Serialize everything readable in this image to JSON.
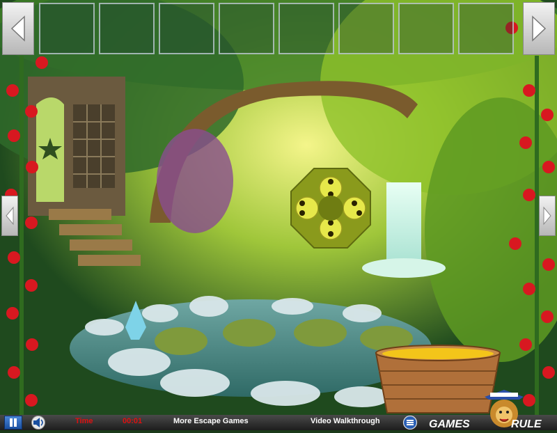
{
  "bottom_bar": {
    "time_label": "Time",
    "time_value": "00:01",
    "more_games": "More Escape Games",
    "walkthrough": "Video Walkthrough",
    "logo_left": "GAMES",
    "logo_right": "RULE"
  },
  "colors": {
    "time_red": "#e01010",
    "puzzle_green": "#8a9a1c",
    "bowl_liquid": "#f3c51a",
    "bowl_wood": "#b0703a"
  },
  "inventory": {
    "slot_count": 8
  },
  "icons": [
    "pause-icon",
    "sound-icon",
    "menu-icon",
    "arrow-left-icon",
    "arrow-right-icon",
    "spade-icon"
  ]
}
